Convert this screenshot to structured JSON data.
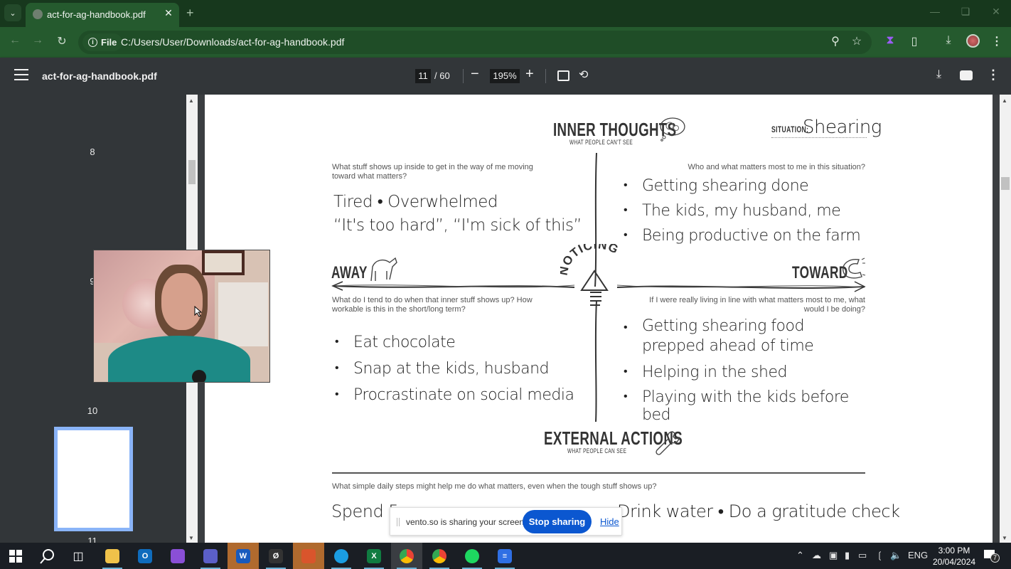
{
  "browser": {
    "tab_title": "act-for-ag-handbook.pdf",
    "omnibox_chip": "File",
    "url": "C:/Users/User/Downloads/act-for-ag-handbook.pdf"
  },
  "viewer": {
    "file_name": "act-for-ag-handbook.pdf",
    "current_page": "11",
    "total_pages": "/ 60",
    "zoom": "195%"
  },
  "sidebar": {
    "page_labels": [
      "8",
      "9",
      "10",
      "11"
    ]
  },
  "document": {
    "header": {
      "inner_thoughts": "INNER THOUGHTS",
      "inner_sub": "WHAT PEOPLE CAN'T SEE",
      "situation_label": "SITUATION:",
      "situation_value": "Shearing"
    },
    "q_top_left": "What stuff shows up inside to get in the way of me moving toward what matters?",
    "top_left_lines": [
      "Tired • Overwhelmed",
      "“It's too hard”, “I'm sick of this”"
    ],
    "q_top_right": "Who and what matters most to me in this situation?",
    "top_right_items": [
      "Getting shearing done",
      "The kids, my husband, me",
      "Being productive on the farm"
    ],
    "away_label": "AWAY",
    "toward_label": "TOWARD",
    "noticing_label": "NOTICING",
    "q_bottom_left": "What do I tend to do when that inner stuff shows up? How workable is this in the short/long term?",
    "bottom_left_items": [
      "Eat chocolate",
      "Snap at the kids, husband",
      "Procrastinate on social media"
    ],
    "q_bottom_right": "If I were really living in line with what matters most to me, what would I be doing?",
    "bottom_right_items": [
      "Getting shearing food prepped ahead of time",
      "Helping in the shed",
      "Playing with the kids before bed"
    ],
    "external_actions": "EXTERNAL ACTIONS",
    "external_sub": "WHAT PEOPLE CAN SEE",
    "q_daily": "What simple daily steps might help me do what matters, even when the tough stuff shows up?",
    "daily_left": "Spend 5",
    "daily_right": "Drink water • Do a gratitude check"
  },
  "share_bar": {
    "message": "vento.so is sharing your screen.",
    "stop_label": "Stop sharing",
    "hide_label": "Hide"
  },
  "taskbar": {
    "apps": [
      "windows-start",
      "search",
      "task-view",
      "file-explorer",
      "outlook",
      "clipchamp",
      "teams",
      "word",
      "app-zero",
      "snipping-tool",
      "edge",
      "excel",
      "chrome",
      "chrome-profile",
      "spotify",
      "google-docs"
    ],
    "language": "ENG",
    "time": "3:00 PM",
    "date": "20/04/2024",
    "notification_count": "7"
  }
}
